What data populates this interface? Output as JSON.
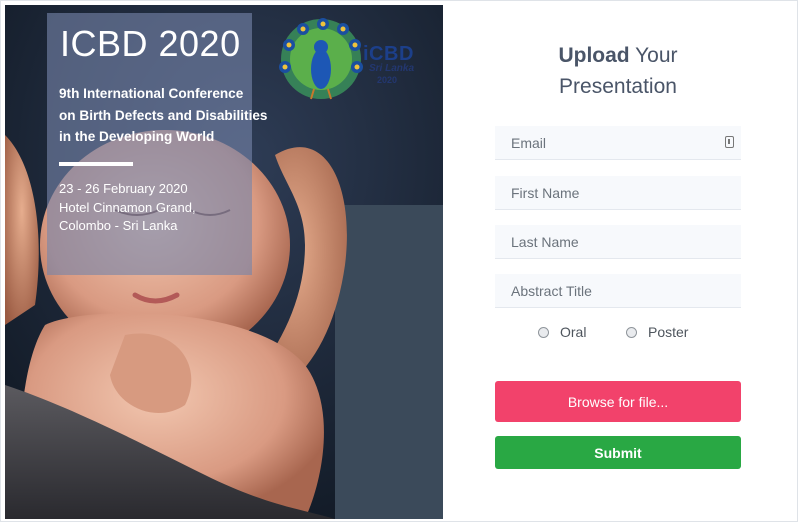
{
  "poster": {
    "title": "ICBD 2020",
    "subtitle_lines": [
      "9th International Conference",
      "on Birth Defects and Disabilities",
      "in the Developing World"
    ],
    "dates": "23 - 26 February 2020",
    "venue_line1": "Hotel Cinnamon Grand,",
    "venue_line2": "Colombo - Sri Lanka",
    "logo": {
      "mark": "iCBD",
      "country": "Sri Lanka",
      "year": "2020"
    }
  },
  "form": {
    "heading_bold": "Upload",
    "heading_rest": " Your",
    "heading_line2": "Presentation",
    "fields": {
      "email_placeholder": "Email",
      "first_name_placeholder": "First Name",
      "last_name_placeholder": "Last Name",
      "abstract_title_placeholder": "Abstract Title"
    },
    "radio_options": [
      "Oral",
      "Poster"
    ],
    "browse_label": "Browse for file...",
    "submit_label": "Submit"
  },
  "colors": {
    "browse_button": "#f2426b",
    "submit_button": "#29a844",
    "field_background": "#f7f9fc",
    "heading_text": "#4a5568"
  },
  "icons": {
    "email_field": "contact-card-icon",
    "radio": "radio-button-icon"
  }
}
